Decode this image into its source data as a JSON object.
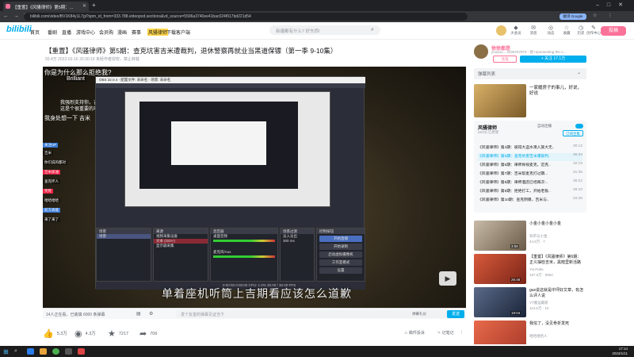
{
  "browser": {
    "tab_title": "【重置】《风骚律师》第5期：...",
    "url": "bilibili.com/video/BV1K84y1L7gi?spm_id_from=333.788.videopod.sections&vd_source=5596a3740ee41bac024f017bd221d54",
    "translate_label": "翻译 Google"
  },
  "header": {
    "logo": "bilibili",
    "nav": [
      "首页",
      "番剧",
      "直播",
      "游戏中心",
      "会员购",
      "漫画",
      "赛事",
      "下载客户端"
    ],
    "search_placeholder": "新疆都有什么? 好东西!",
    "icons": [
      {
        "name": "大会员",
        "glyph": "◆"
      },
      {
        "name": "消息",
        "glyph": "✉"
      },
      {
        "name": "动态",
        "glyph": "◎"
      },
      {
        "name": "收藏",
        "glyph": "☆"
      },
      {
        "name": "历史",
        "glyph": "◷"
      },
      {
        "name": "创作中心",
        "glyph": "✎"
      }
    ],
    "upload_label": "投稿"
  },
  "video": {
    "title": "【重置】《风骚律师》第5期：查克坑害吉米遭裁判，退休警察再就业当黑道保镖（第一季 9-10集）",
    "meta": "93.4万   2022-02-16 20:30:19   未经作者授权，禁止转载",
    "overlay_top": "你是为什么那么拒绝我?",
    "overlay_brilliant": "Brilliant",
    "overlay_line2": "我强烈支持你，吉米",
    "overlay_line3": "这是个很重要的项目",
    "overlay_line4": "我身处想一下 吉米",
    "subtitle": "单着座机听筒上吉期看应该怎么道歉",
    "danmaku": [
      "关注UP",
      "吉米",
      "你们说的都对",
      "吉米加油",
      "查克坏人",
      "笑死",
      "哈哈哈哈",
      "前方高能",
      "来了来了"
    ]
  },
  "obs": {
    "title": "OBS 32.0.4 - 配置文件: 未命名 - 场景: 未命名",
    "panels": [
      "场景",
      "来源",
      "混音器",
      "场景过渡",
      "控制按钮"
    ],
    "scene": "场景",
    "sources": [
      "视频采集设备",
      "文本 (GDI+)",
      "显示器采集"
    ],
    "mixer": [
      "桌面音频",
      "麦克风/Aux"
    ],
    "controls": [
      "开始直播",
      "开始录制",
      "启动虚拟摄像机",
      "工作室模式",
      "设置",
      "退出"
    ],
    "transition": "淡入淡出",
    "duration": "300 ms",
    "status": "0:00:00   0:00:00   CPU: 1.0%   30.00 / 30.00 FPS"
  },
  "video_bar": {
    "viewers": "14人正在看，已装填 6000 条弹幕",
    "danmaku_placeholder": "发个友善的弹幕见证当下",
    "etiquette": "弹幕礼仪",
    "send": "发送"
  },
  "actions": {
    "like": "5.3万",
    "coin": "4.3万",
    "fav": "7217",
    "share": "706",
    "report": "稿件投诉",
    "notes": "记笔记"
  },
  "up": {
    "name": "徐徐都是",
    "desc": "youyou... 2226767870 · 想 representing the A...",
    "charge": "充电",
    "follow": "+ 关注 17.1万"
  },
  "sidebar": {
    "danmu_list": "弹幕列表",
    "ad_title": "一家暖房子的事儿，好说，好说",
    "playlist": {
      "title": "风骚律师",
      "count": "(6/23) 已更新",
      "autoplay": "自动连播",
      "subscribe": "订阅合集",
      "items": [
        {
          "title": "《风骚律师》第4期：彼得大盗水淹人族大无..",
          "dur": "30:12"
        },
        {
          "title": "《风骚律师》第5期：查克坑害吉米遭裁判..",
          "dur": "36:34"
        },
        {
          "title": "《风骚律师》第6期：律师探视麦克，迈克..",
          "dur": "32:19"
        },
        {
          "title": "《风骚律师》第7期：吉米帮麦克打过期...",
          "dur": "31:35"
        },
        {
          "title": "《风骚律师》第8期：律师酒店已经再次-..",
          "dur": "35:22"
        },
        {
          "title": "《风骚律师》第9期：拒绝打工，开始老板..",
          "dur": "28:10"
        },
        {
          "title": "《风骚律师》第10期：查克阴暴，吉米与..",
          "dur": "34:45"
        }
      ]
    },
    "recs": [
      {
        "title": "小金小金小金小金",
        "up": "背带与小金",
        "stats": "44.8万  · 7",
        "dur": "3:58"
      },
      {
        "title": "【重置】《风骚律师》第6期：正义抽检吉米，黑暗里新活路",
        "up": "YouTube",
        "stats": "197.6万 · 5952",
        "dur": "26:48"
      },
      {
        "title": "gus说这就是中坪好文章，有怎么评人说",
        "up": "YT搬运最新",
        "stats": "113.5万 · 10",
        "dur": "18:04"
      },
      {
        "title": "我信了，没见骨折发死",
        "up": "哈哈哈哈人",
        "stats": "",
        "dur": ""
      }
    ]
  },
  "taskbar": {
    "time": "17:14",
    "date": "2023/1/11"
  }
}
